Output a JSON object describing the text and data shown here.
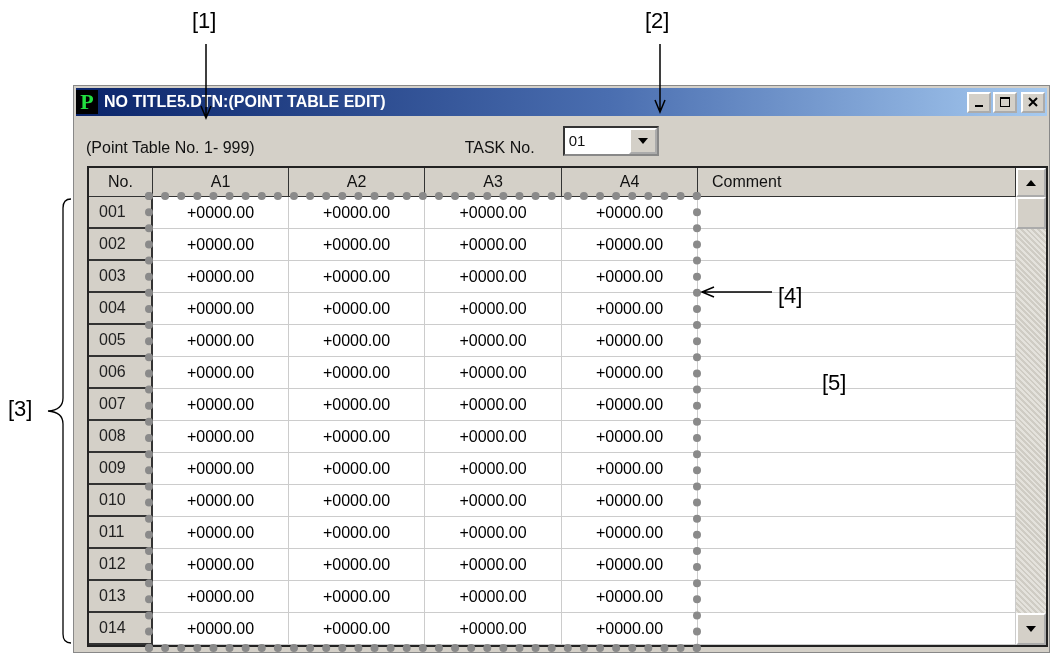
{
  "window": {
    "title": "NO TITLE5.DTN:(POINT TABLE EDIT)",
    "icon_letter": "P"
  },
  "range_label": "(Point Table No. 1- 999)",
  "task": {
    "label": "TASK No.",
    "value": "01"
  },
  "table": {
    "columns": [
      "No.",
      "A1",
      "A2",
      "A3",
      "A4",
      "Comment"
    ],
    "rows": [
      {
        "no": "001",
        "values": [
          "+0000.00",
          "+0000.00",
          "+0000.00",
          "+0000.00"
        ]
      },
      {
        "no": "002",
        "values": [
          "+0000.00",
          "+0000.00",
          "+0000.00",
          "+0000.00"
        ]
      },
      {
        "no": "003",
        "values": [
          "+0000.00",
          "+0000.00",
          "+0000.00",
          "+0000.00"
        ]
      },
      {
        "no": "004",
        "values": [
          "+0000.00",
          "+0000.00",
          "+0000.00",
          "+0000.00"
        ]
      },
      {
        "no": "005",
        "values": [
          "+0000.00",
          "+0000.00",
          "+0000.00",
          "+0000.00"
        ]
      },
      {
        "no": "006",
        "values": [
          "+0000.00",
          "+0000.00",
          "+0000.00",
          "+0000.00"
        ]
      },
      {
        "no": "007",
        "values": [
          "+0000.00",
          "+0000.00",
          "+0000.00",
          "+0000.00"
        ]
      },
      {
        "no": "008",
        "values": [
          "+0000.00",
          "+0000.00",
          "+0000.00",
          "+0000.00"
        ]
      },
      {
        "no": "009",
        "values": [
          "+0000.00",
          "+0000.00",
          "+0000.00",
          "+0000.00"
        ]
      },
      {
        "no": "010",
        "values": [
          "+0000.00",
          "+0000.00",
          "+0000.00",
          "+0000.00"
        ]
      },
      {
        "no": "011",
        "values": [
          "+0000.00",
          "+0000.00",
          "+0000.00",
          "+0000.00"
        ]
      },
      {
        "no": "012",
        "values": [
          "+0000.00",
          "+0000.00",
          "+0000.00",
          "+0000.00"
        ]
      },
      {
        "no": "013",
        "values": [
          "+0000.00",
          "+0000.00",
          "+0000.00",
          "+0000.00"
        ]
      },
      {
        "no": "014",
        "values": [
          "+0000.00",
          "+0000.00",
          "+0000.00",
          "+0000.00"
        ]
      }
    ]
  },
  "callouts": [
    {
      "label": "[1]"
    },
    {
      "label": "[2]"
    },
    {
      "label": "[3]"
    },
    {
      "label": "[4]"
    },
    {
      "label": "[5]"
    }
  ]
}
